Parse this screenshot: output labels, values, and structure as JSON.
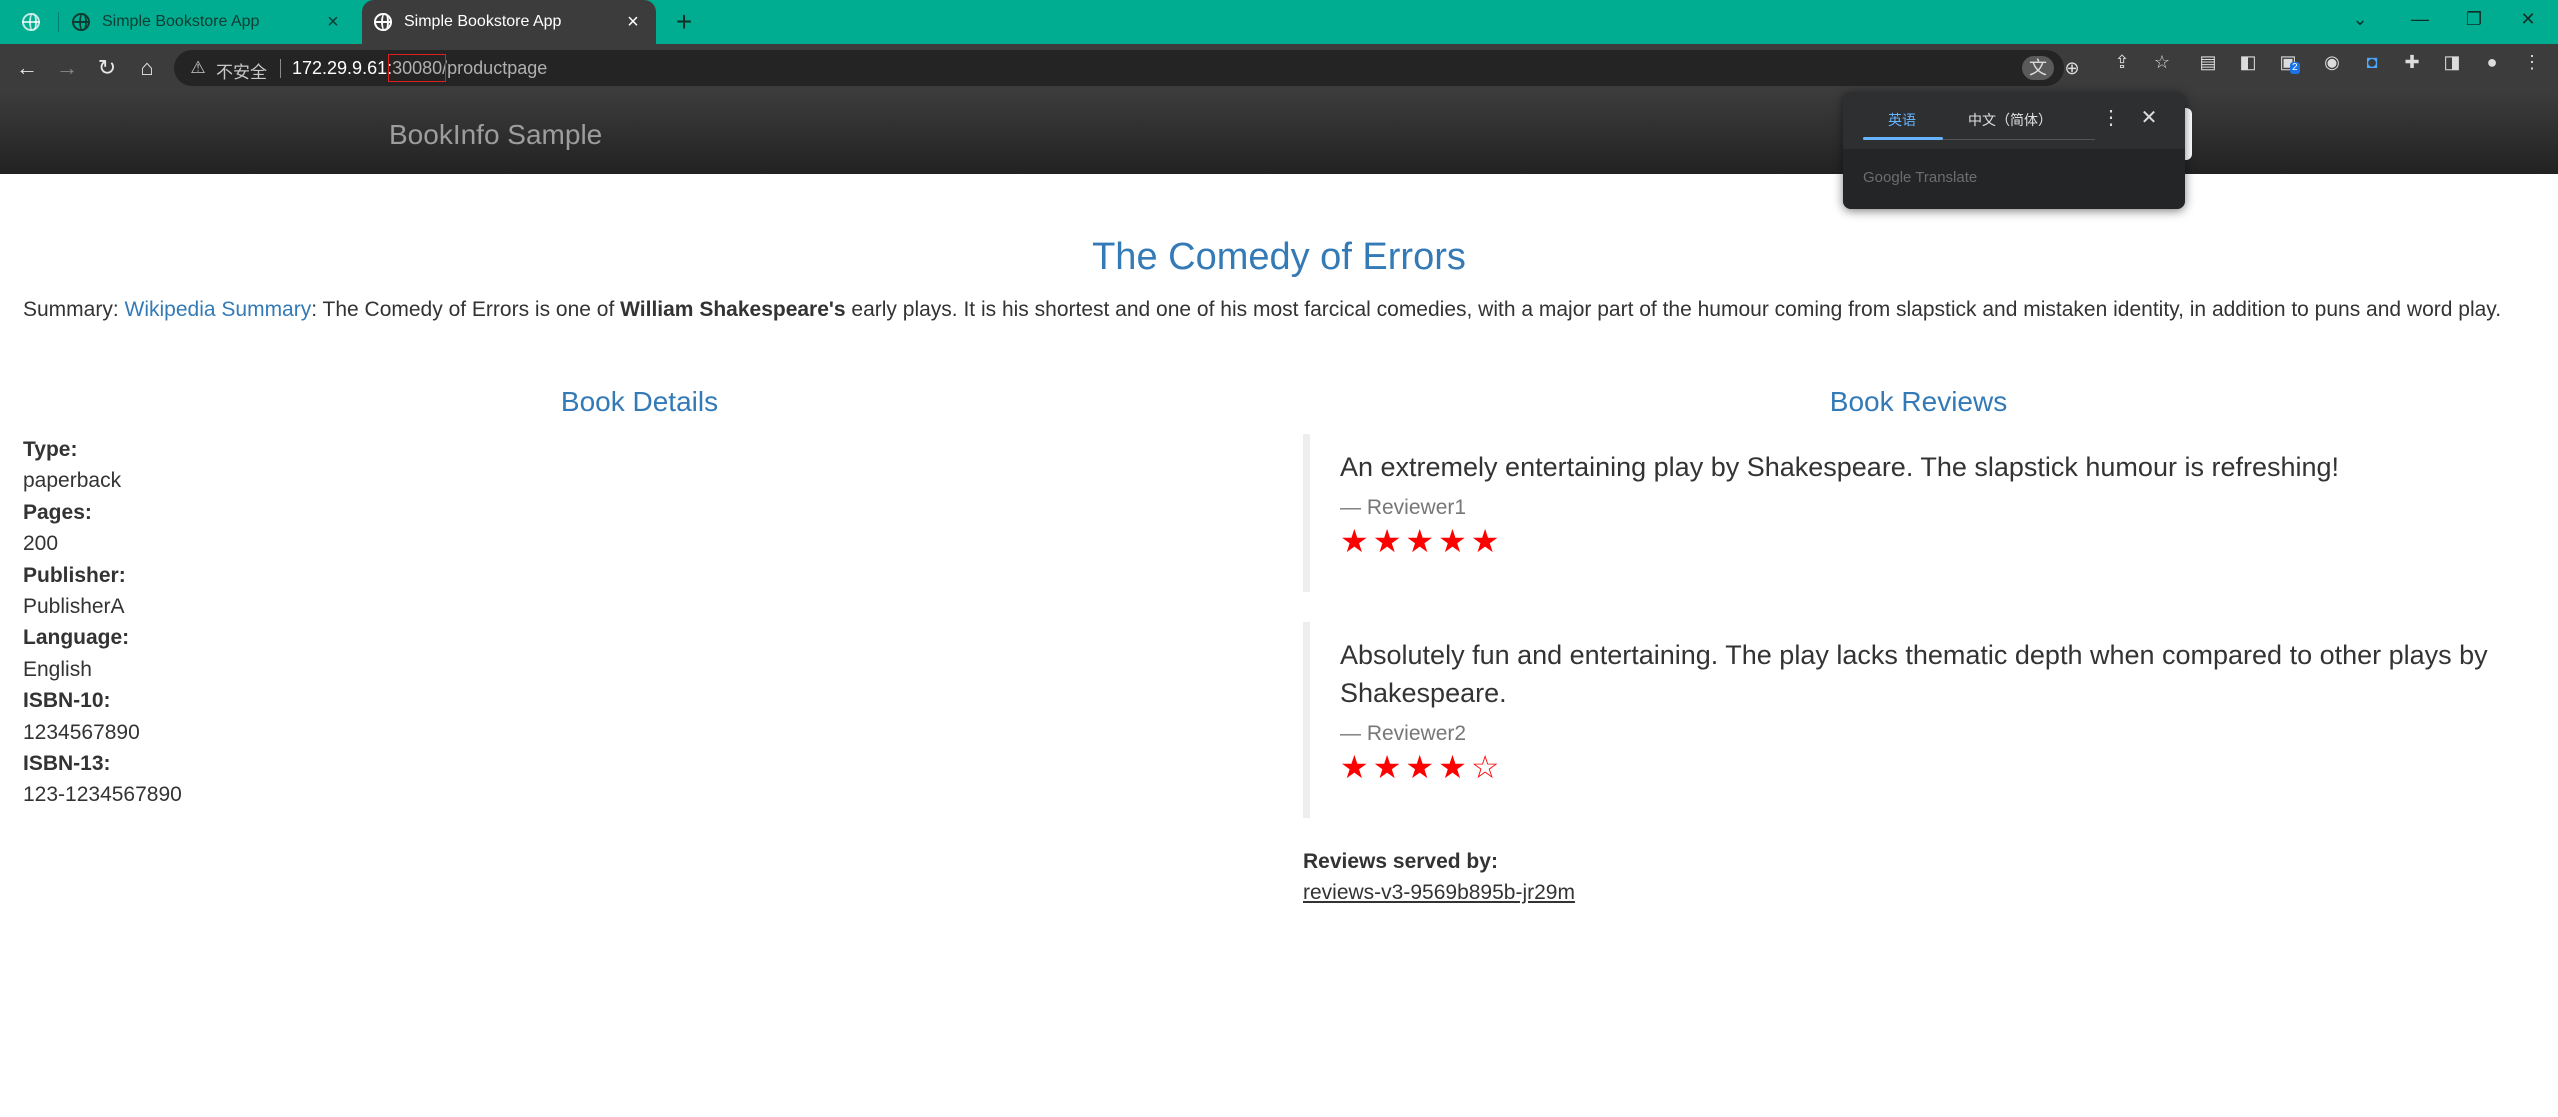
{
  "browser": {
    "tabs": [
      {
        "title": "Simple Bookstore App",
        "active": false
      },
      {
        "title": "Simple Bookstore App",
        "active": true
      }
    ],
    "new_tab": "+",
    "window_controls": {
      "minimize": "—",
      "restore": "❐",
      "close": "✕",
      "tab_search": "⌄"
    },
    "address_bar": {
      "security_label": "不安全",
      "host": "172.29.9.61:",
      "port": "30080",
      "path": "/productpage"
    },
    "icons": [
      "translate-icon",
      "zoom-icon",
      "share-icon",
      "bookmark-star-icon",
      "extension-icon",
      "profile-icon",
      "menu-icon"
    ],
    "extension_badge": "2",
    "accent_color": "#00ad90"
  },
  "translate_popup": {
    "source_lang": "英语",
    "target_lang": "中文（简体）",
    "footer": "Google Translate"
  },
  "navbar": {
    "brand": "BookInfo Sample"
  },
  "book": {
    "title": "The Comedy of Errors",
    "summary_prefix": "Summary: ",
    "summary_link": "Wikipedia Summary",
    "summary_part1": ": The Comedy of Errors is one of ",
    "summary_bold": "William Shakespeare's",
    "summary_part2": " early plays. It is his shortest and one of his most farcical comedies, with a major part of the humour coming from slapstick and mistaken identity, in addition to puns and word play."
  },
  "details": {
    "heading": "Book Details",
    "fields": [
      {
        "label": "Type:",
        "value": "paperback"
      },
      {
        "label": "Pages:",
        "value": "200"
      },
      {
        "label": "Publisher:",
        "value": "PublisherA"
      },
      {
        "label": "Language:",
        "value": "English"
      },
      {
        "label": "ISBN-10:",
        "value": "1234567890"
      },
      {
        "label": "ISBN-13:",
        "value": "123-1234567890"
      }
    ]
  },
  "reviews": {
    "heading": "Book Reviews",
    "star_color": "#ff0000",
    "items": [
      {
        "text": "An extremely entertaining play by Shakespeare. The slapstick humour is refreshing!",
        "author": "— Reviewer1",
        "stars": "★★★★★",
        "rating": 5
      },
      {
        "text": "Absolutely fun and entertaining. The play lacks thematic depth when compared to other plays by Shakespeare.",
        "author": "— Reviewer2",
        "stars": "★★★★☆",
        "rating": 4
      }
    ],
    "served_by_label": "Reviews served by:",
    "served_by_value": "reviews-v3-9569b895b-jr29m"
  }
}
